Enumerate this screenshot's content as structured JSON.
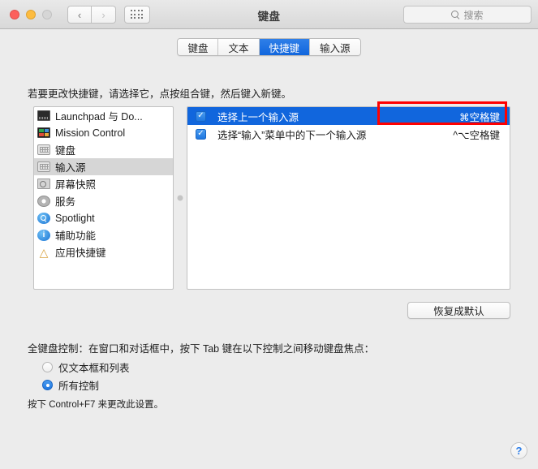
{
  "window": {
    "title": "键盘",
    "traffic_lights": [
      "close",
      "minimize",
      "zoom"
    ],
    "nav_back_icon": "chevron-left-icon",
    "nav_forward_icon": "chevron-right-icon",
    "grid_icon": "show-all-preferences-icon"
  },
  "search": {
    "placeholder": "搜索",
    "icon": "search-icon"
  },
  "tabs": [
    {
      "label": "键盘",
      "active": false
    },
    {
      "label": "文本",
      "active": false
    },
    {
      "label": "快捷键",
      "active": true
    },
    {
      "label": "输入源",
      "active": false
    }
  ],
  "hint": "若要更改快捷键，请选择它，点按组合键，然后键入新键。",
  "categories": [
    {
      "label": "Launchpad 与 Do...",
      "icon": "launchpad-icon",
      "selected": false
    },
    {
      "label": "Mission Control",
      "icon": "mission-control-icon",
      "selected": false
    },
    {
      "label": "键盘",
      "icon": "keyboard-icon",
      "selected": false
    },
    {
      "label": "输入源",
      "icon": "keyboard-icon",
      "selected": true
    },
    {
      "label": "屏幕快照",
      "icon": "camera-icon",
      "selected": false
    },
    {
      "label": "服务",
      "icon": "gear-icon",
      "selected": false
    },
    {
      "label": "Spotlight",
      "icon": "spotlight-icon",
      "selected": false
    },
    {
      "label": "辅助功能",
      "icon": "accessibility-icon",
      "selected": false
    },
    {
      "label": "应用快捷键",
      "icon": "app-store-icon",
      "selected": false
    }
  ],
  "shortcuts": [
    {
      "name": "选择上一个输入源",
      "key": "⌘空格键",
      "checked": true,
      "selected": true
    },
    {
      "name": "选择“输入”菜单中的下一个输入源",
      "key": "^⌥空格键",
      "checked": true,
      "selected": false
    }
  ],
  "restore_button": "恢复成默认",
  "full_keyboard_access": {
    "label": "全键盘控制：在窗口和对话框中，按下 Tab 键在以下控制之间移动键盘焦点：",
    "options": [
      {
        "label": "仅文本框和列表",
        "selected": false
      },
      {
        "label": "所有控制",
        "selected": true
      }
    ],
    "note": "按下 Control+F7 来更改此设置。"
  },
  "help_button": "?",
  "annotation": {
    "color": "#ff0000",
    "target": "⌘空格键"
  },
  "colors": {
    "accent": "#1166dd",
    "selection_gray": "#d6d6d6",
    "window_bg": "#ececec",
    "annotation_red": "#ff0000"
  }
}
